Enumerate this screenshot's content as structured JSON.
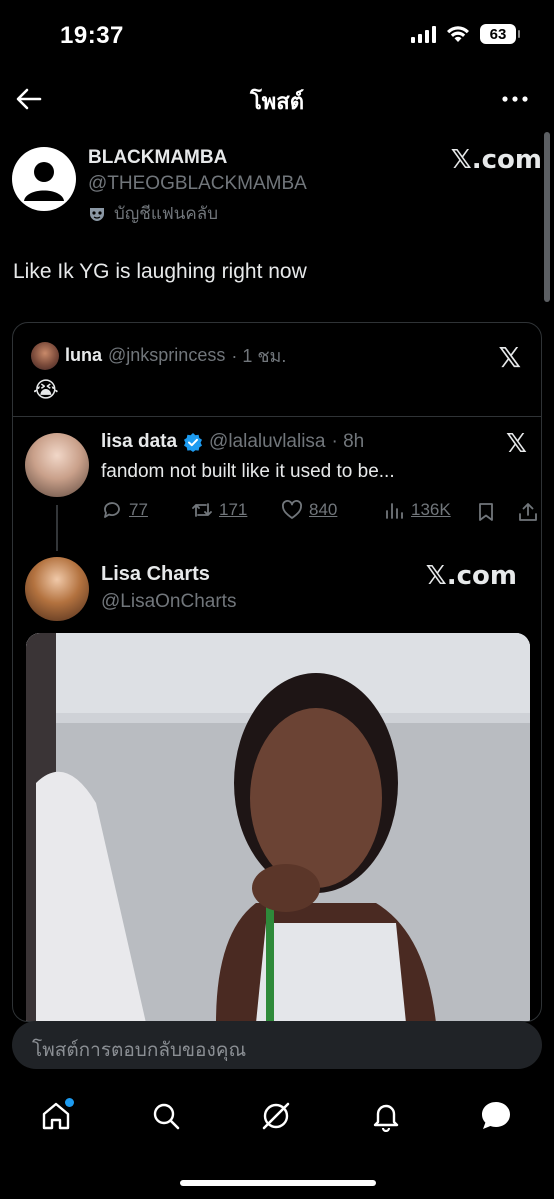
{
  "status": {
    "time": "19:37",
    "battery": "63"
  },
  "header": {
    "title": "โพสต์"
  },
  "post": {
    "author_name": "BLACKMAMBA",
    "author_handle": "@THEOGBLACKMAMBA",
    "badge_label": "บัญชีแฟนคลับ",
    "brand": "𝕏.com",
    "text": "Like Ik YG is laughing right now"
  },
  "quote": {
    "name": "luna",
    "handle": "@jnksprincess",
    "time": "· 1 ชม.",
    "brand": "𝕏",
    "emoji": "😭",
    "inner": {
      "name": "lisa data",
      "handle": "@lalaluvlalisa",
      "time": "· 8h",
      "brand": "𝕏",
      "text": "fandom not built like it used to be...",
      "replies": "77",
      "retweets": "171",
      "likes": "840",
      "views": "136K"
    },
    "charts": {
      "name": "Lisa Charts",
      "handle": "@LisaOnCharts",
      "brand": "𝕏.com"
    }
  },
  "reply_bar": {
    "placeholder": "โพสต์การตอบกลับของคุณ"
  },
  "colors": {
    "background": "#000000",
    "accent": "#1d9bf0",
    "muted": "#71767b"
  }
}
